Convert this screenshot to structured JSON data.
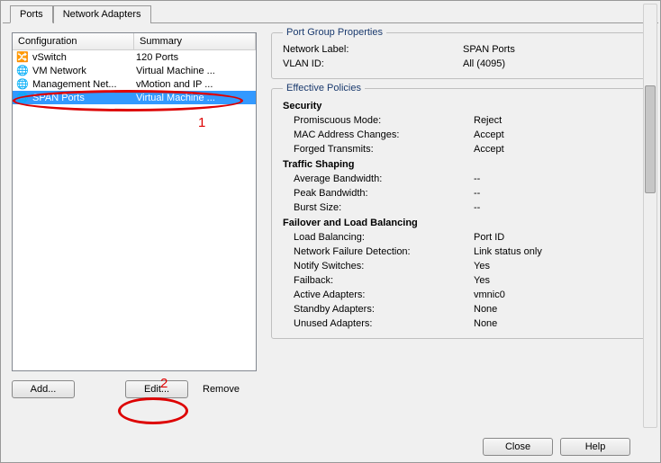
{
  "tabs": {
    "ports": "Ports",
    "net": "Network Adapters"
  },
  "columns": {
    "conf": "Configuration",
    "sum": "Summary"
  },
  "rows": [
    {
      "icon": "🔀",
      "name": "vSwitch",
      "summary": "120 Ports"
    },
    {
      "icon": "🌐",
      "name": "VM Network",
      "summary": "Virtual Machine ..."
    },
    {
      "icon": "🌐",
      "name": "Management Net...",
      "summary": "vMotion and IP ..."
    },
    {
      "icon": "🌐",
      "name": "SPAN Ports",
      "summary": "Virtual Machine ..."
    }
  ],
  "buttons": {
    "add": "Add...",
    "edit": "Edit...",
    "remove": "Remove",
    "close": "Close",
    "help": "Help"
  },
  "groupProps": {
    "title": "Port Group Properties",
    "netLabelK": "Network Label:",
    "netLabelV": "SPAN Ports",
    "vlanK": "VLAN ID:",
    "vlanV": "All (4095)"
  },
  "policies": {
    "title": "Effective Policies",
    "security": "Security",
    "promK": "Promiscuous Mode:",
    "promV": "Reject",
    "macK": "MAC Address Changes:",
    "macV": "Accept",
    "forgedK": "Forged Transmits:",
    "forgedV": "Accept",
    "shaping": "Traffic Shaping",
    "avgK": "Average Bandwidth:",
    "avgV": "--",
    "peakK": "Peak Bandwidth:",
    "peakV": "--",
    "burstK": "Burst Size:",
    "burstV": "--",
    "failover": "Failover and Load Balancing",
    "lbK": "Load Balancing:",
    "lbV": "Port ID",
    "nfdK": "Network Failure Detection:",
    "nfdV": "Link status only",
    "nsK": "Notify Switches:",
    "nsV": "Yes",
    "fbK": "Failback:",
    "fbV": "Yes",
    "aaK": "Active Adapters:",
    "aaV": "vmnic0",
    "saK": "Standby Adapters:",
    "saV": "None",
    "uaK": "Unused Adapters:",
    "uaV": "None"
  },
  "annotations": {
    "one": "1",
    "two": "2"
  }
}
